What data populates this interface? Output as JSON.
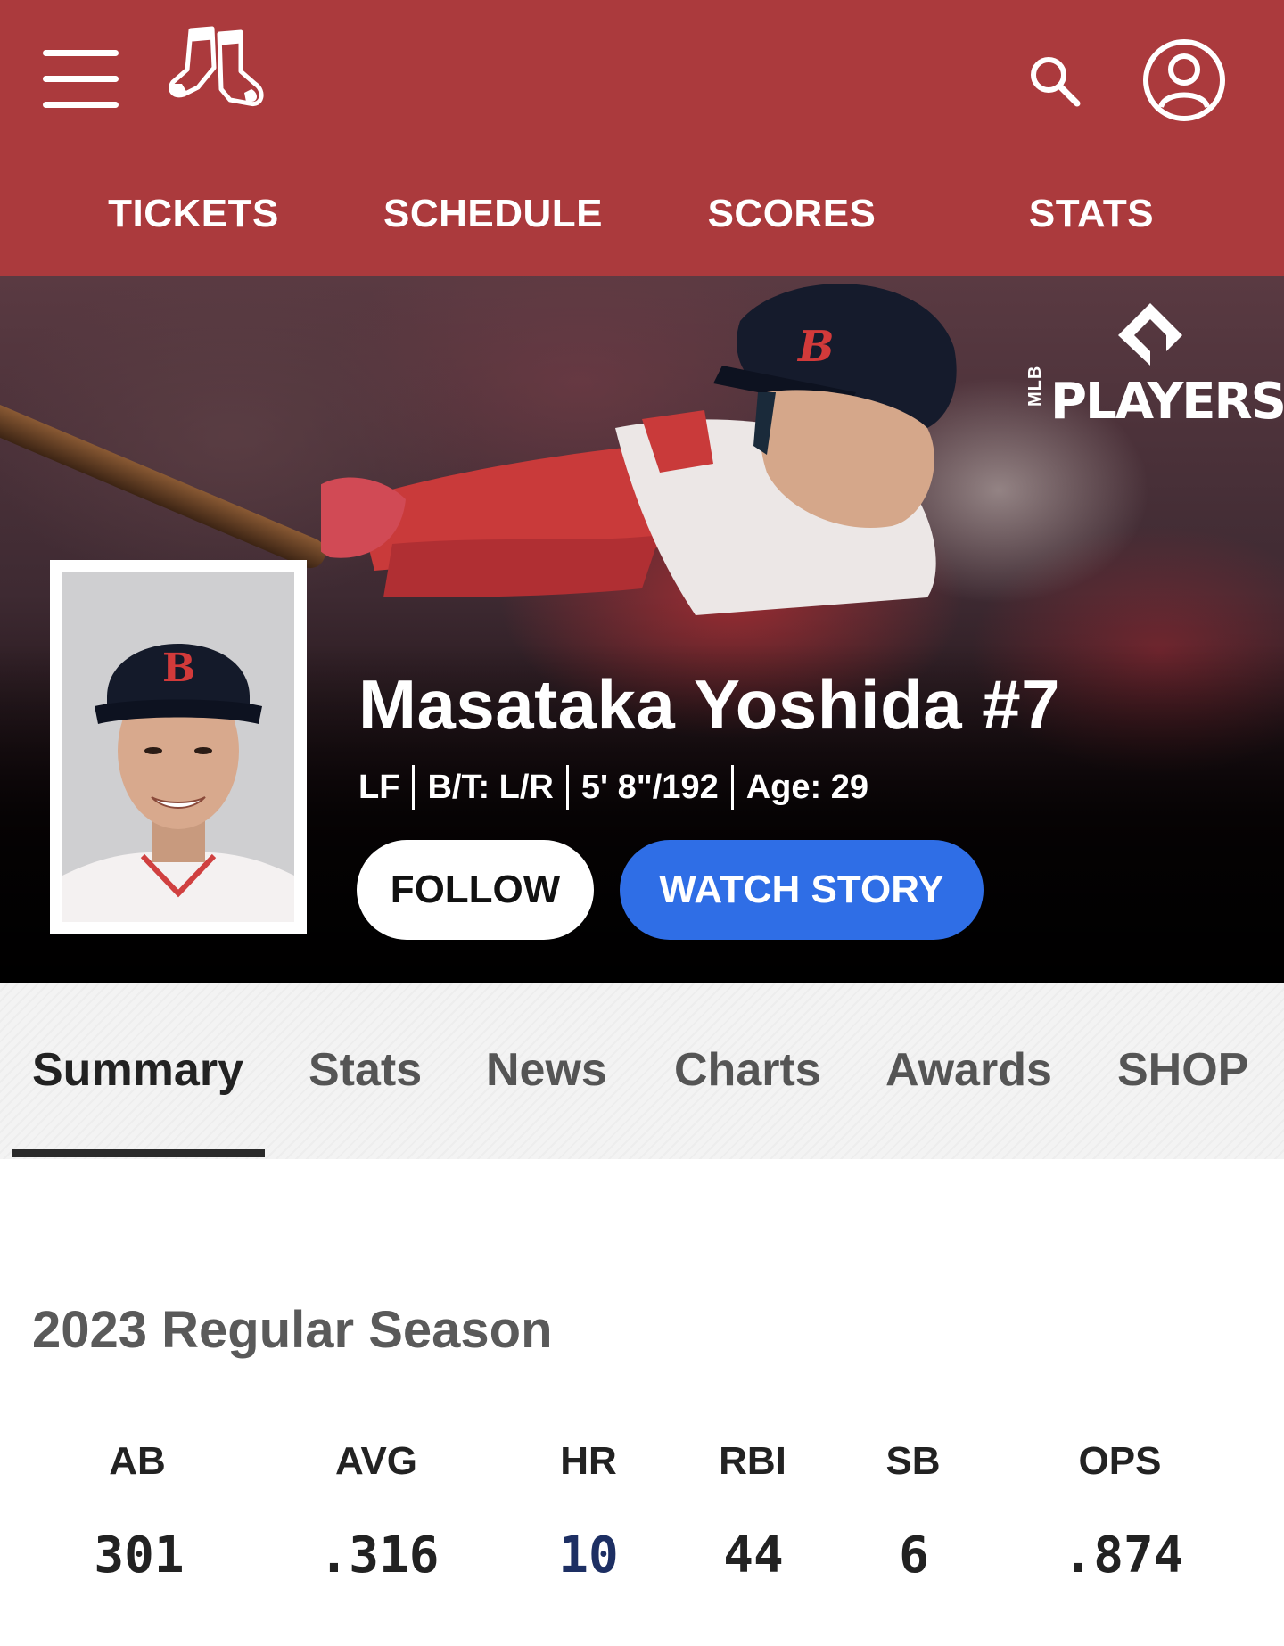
{
  "header": {
    "team_logo": "red-sox-logo",
    "nav": [
      {
        "label": "TICKETS"
      },
      {
        "label": "SCHEDULE"
      },
      {
        "label": "SCORES"
      },
      {
        "label": "STATS"
      }
    ],
    "colors": {
      "bar": "#ab3a3d"
    }
  },
  "hero": {
    "badge": {
      "small": "MLB",
      "word": "PLAYERS"
    },
    "player_name": "Masataka Yoshida #7",
    "meta": [
      "LF",
      "B/T: L/R",
      "5' 8\"/192",
      "Age: 29"
    ],
    "follow_label": "FOLLOW",
    "watch_label": "WATCH STORY",
    "colors": {
      "watch": "#2f6ee6"
    }
  },
  "tabs": [
    {
      "label": "Summary",
      "active": true
    },
    {
      "label": "Stats"
    },
    {
      "label": "News"
    },
    {
      "label": "Charts"
    },
    {
      "label": "Awards"
    },
    {
      "label": "SHOP"
    }
  ],
  "season": {
    "title": "2023 Regular Season",
    "stats": [
      {
        "label": "AB",
        "value": "301"
      },
      {
        "label": "AVG",
        "value": ".316"
      },
      {
        "label": "HR",
        "value": "10"
      },
      {
        "label": "RBI",
        "value": "44"
      },
      {
        "label": "SB",
        "value": "6"
      },
      {
        "label": "OPS",
        "value": ".874"
      }
    ]
  }
}
